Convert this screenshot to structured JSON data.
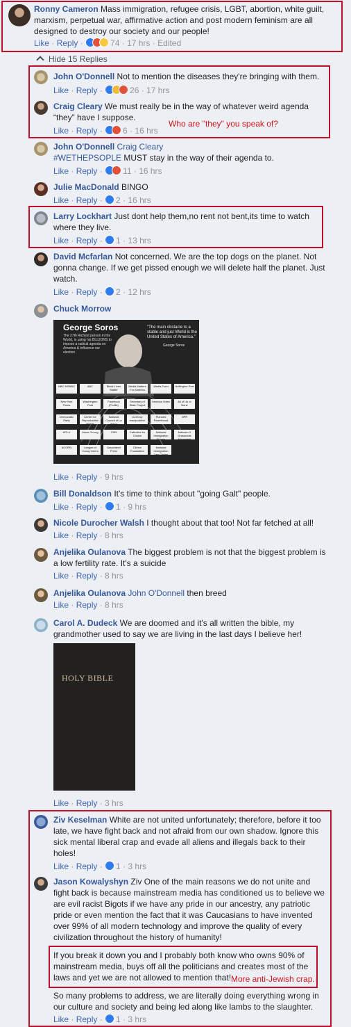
{
  "top_comment": {
    "author": "Ronny Cameron",
    "text": "Mass immigration, refugee crisis, LGBT, abortion, white guilt, marxism, perpetual war, affirmative action and post modern feminism are all designed to destroy our society and our people!",
    "like": "Like",
    "reply": "Reply",
    "reaction_count": "74",
    "time": "17 hrs",
    "edited": "Edited"
  },
  "hide_replies": "Hide 15 Replies",
  "replies": [
    {
      "author": "John O'Donnell",
      "text": "Not to mention the diseases they're bringing with them.",
      "reaction_count": "26",
      "time": "17 hrs"
    },
    {
      "author": "Craig Cleary",
      "text": "We must really be in the way of whatever weird agenda “they” have I suppose.",
      "reaction_count": "6",
      "time": "16 hrs"
    },
    {
      "author": "John O'Donnell",
      "mention": "Craig Cleary",
      "hashtag": "#WETHEPSOPLE",
      "text": "MUST stay in the way of their agenda to.",
      "reaction_count": "11",
      "time": "16 hrs"
    },
    {
      "author": "Julie MacDonald",
      "text": "BINGO",
      "reaction_count": "2",
      "time": "16 hrs"
    },
    {
      "author": "Larry Lockhart",
      "text": "Just dont help them,no rent not bent,its time to watch where they live.",
      "reaction_count": "1",
      "time": "13 hrs"
    },
    {
      "author": "David Mcfarlan",
      "text": "Not concerned. We are the top dogs on the planet. Not gonna change. If we get pissed enough we will delete half the planet. Just watch.",
      "reaction_count": "2",
      "time": "12 hrs"
    },
    {
      "author": "Chuck Morrow",
      "time": "9 hrs"
    },
    {
      "author": "Bill Donaldson",
      "text": "It's time to think about \"going Galt\" people.",
      "reaction_count": "1",
      "time": "9 hrs"
    },
    {
      "author": "Nicole Durocher Walsh",
      "text": "I thought about that too! Not far fetched at all!",
      "time": "8 hrs"
    },
    {
      "author": "Anjelika Oulanova",
      "text": "The biggest problem is not that the biggest problem is a low fertility rate. It's a suicide",
      "time": "8 hrs"
    },
    {
      "author": "Anjelika Oulanova",
      "mention": "John O'Donnell",
      "text": "then breed",
      "time": "8 hrs"
    },
    {
      "author": "Carol A. Dudeck",
      "text": "We are doomed and it's all written the bible, my grandmother used to say we are living in the last days I believe her!",
      "time": "3 hrs"
    },
    {
      "author": "Ziv Keselman",
      "text": "White are not united unfortunately; therefore, before it too late, we have fight back and not afraid from our own shadow. Ignore this sick mental liberal crap and evade all aliens and illegals back to their holes!",
      "reaction_count": "1",
      "time": "3 hrs"
    },
    {
      "author": "Jason Kowalyshyn",
      "text": "Ziv One of the main reasons we do not unite and fight back is because mainstream media has conditioned us to believe we are evil racist Bigots if we have any pride in our ancestry, any patriotic pride or even mention the fact that it was Caucasians to have invented over 99% of all modern technology and improve the quality of every civilization throughout the history of humanity!",
      "text2": "If you break it down you and I probably both know who owns 90% of mainstream media, buys off all the politicians and creates most of the laws and yet we are not allowed to mention that!",
      "text3": "So many problems to address, we are literally doing everything wrong in our culture and society and being led along like lambs to the slaughter.",
      "reaction_count": "1",
      "time": "3 hrs"
    }
  ],
  "labels": {
    "like": "Like",
    "reply": "Reply"
  },
  "annotations": {
    "they_note": "Who are \"they\" you speak of?",
    "anti_jewish_note": "More anti-Jewish crap."
  },
  "soros_image": {
    "heading": "George Soros",
    "blurb": "The 27th Richest person in the World, is using his BILLIONS to impose a radical agenda on America & influence our election",
    "quote": "\"The main obstacle to a stable and just World is the United States of America.\"",
    "quote_attr": "George Soros",
    "orgs": [
      "NBC MSNBC",
      "ABC",
      "Black Lives Matter",
      "Media Matters For America",
      "Media Fund",
      "Huffington Post",
      "New York Times",
      "Washington Post",
      "Facebook (Profile)",
      "Secretary of State Project",
      "America Votes",
      "All of Us or None",
      "Democratic Party",
      "Center for Reproductive Rights",
      "National Council of La Raza",
      "currency manipulation",
      "Planned Parenthood",
      "NPR",
      "ACLU",
      "Move On.org",
      "CNN",
      "Catholics for Choice",
      "National Immigration Forum",
      "Malcolm X Grassroots Movement",
      "ACORN",
      "League of Young Voters",
      "Associated Press",
      "Clinton Foundation",
      "National Immigration Law Center"
    ]
  },
  "bible_image": {
    "title": "HOLY BIBLE"
  },
  "colors": {
    "link": "#365899",
    "action": "#4267b2",
    "meta": "#90949c",
    "highlight": "#c0102c",
    "note": "#d0161c"
  }
}
